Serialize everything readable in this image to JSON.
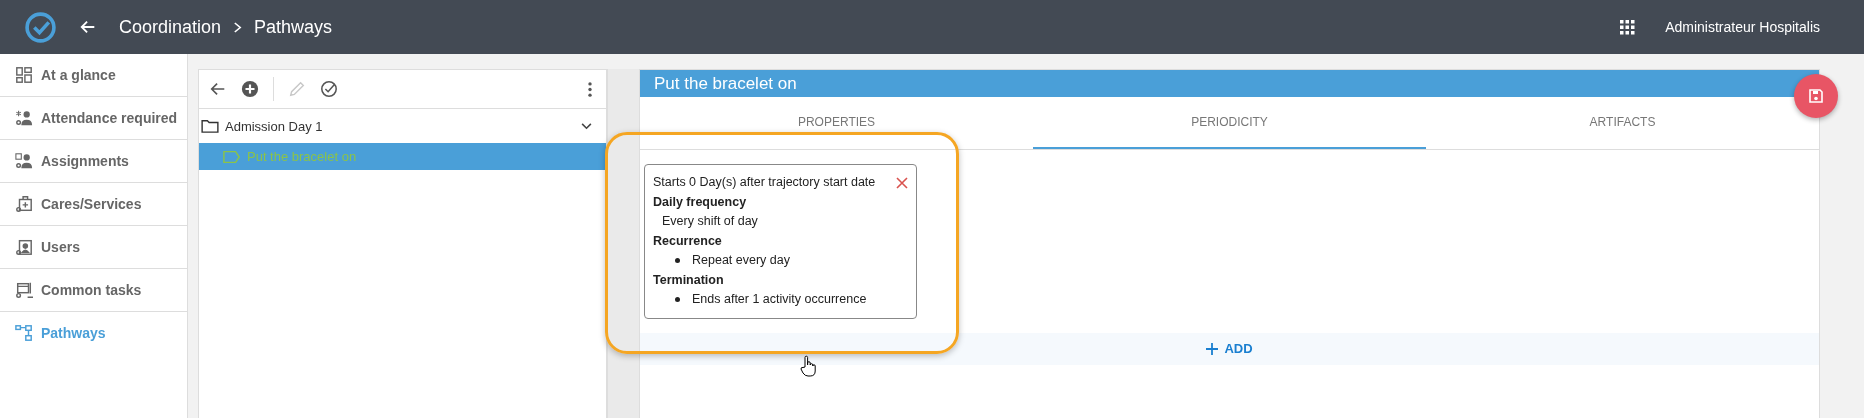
{
  "header": {
    "breadcrumb": [
      "Coordination",
      "Pathways"
    ],
    "user": "Administrateur Hospitalis"
  },
  "sidebar": {
    "items": [
      {
        "label": "At a glance",
        "kind": "glance",
        "selected": false
      },
      {
        "label": "Attendance required",
        "kind": "attendance",
        "selected": false
      },
      {
        "label": "Assignments",
        "kind": "assignments",
        "selected": false
      },
      {
        "label": "Cares/Services",
        "kind": "cares",
        "selected": false
      },
      {
        "label": "Users",
        "kind": "users",
        "selected": false
      },
      {
        "label": "Common tasks",
        "kind": "tasks",
        "selected": false
      },
      {
        "label": "Pathways",
        "kind": "pathways",
        "selected": true
      }
    ]
  },
  "tree": {
    "toolbar": [
      {
        "kind": "back",
        "disabled": false
      },
      {
        "kind": "add",
        "disabled": false
      },
      {
        "kind": "edit",
        "disabled": true
      },
      {
        "kind": "validate",
        "disabled": false
      }
    ],
    "nodes": [
      {
        "label": "Admission Day 1",
        "kind": "folder",
        "expanded": true,
        "selected": false,
        "children": [
          {
            "label": "Put the bracelet on",
            "kind": "task",
            "selected": true
          }
        ]
      }
    ]
  },
  "detail": {
    "title": "Put the bracelet on",
    "tabs": [
      {
        "label": "PROPERTIES",
        "selected": false
      },
      {
        "label": "PERIODICITY",
        "selected": true
      },
      {
        "label": "ARTIFACTS",
        "selected": false
      }
    ],
    "rules": [
      {
        "start": "Starts 0 Day(s) after trajectory start date",
        "sections": [
          {
            "heading": "Daily frequency",
            "kind": "plain",
            "lines": [
              "Every shift of day"
            ]
          },
          {
            "heading": "Recurrence",
            "kind": "bullets",
            "lines": [
              "Repeat every day"
            ]
          },
          {
            "heading": "Termination",
            "kind": "bullets",
            "lines": [
              "Ends after 1 activity occurrence"
            ]
          }
        ]
      }
    ],
    "add_label": "ADD"
  }
}
